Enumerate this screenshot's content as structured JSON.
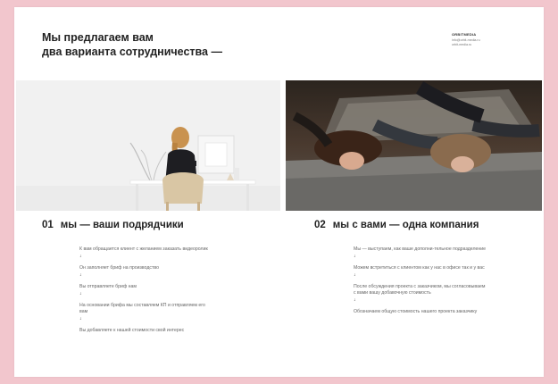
{
  "header": {
    "title_line1": "Мы предлагаем вам",
    "title_line2": "два варианта сотрудничества —"
  },
  "brand": {
    "name": "ORBITMEDIA",
    "contact1": "info@orbit-media.ru",
    "contact2": "orbit-media.ru"
  },
  "sections": [
    {
      "number": "01",
      "heading": "мы — ваши подрядчики",
      "steps": [
        "К вам обращается клиент с желанием заказать видеоролик",
        "Он заполняет бриф на производство",
        "Вы отправляете бриф нам",
        "На основании брифа мы составляем КП и отправляем его вам",
        "Вы добавляете к нашей стоимости свой интерес"
      ]
    },
    {
      "number": "02",
      "heading": "мы с вами — одна компания",
      "steps": [
        "Мы — выступаем, как ваше дополни-тельное подразделение",
        "Можем встретиться с клиентом как у нас в офисе так и у вас",
        "После обсуждения проекта с заказчиком, мы согласовываем с вами вашу добавочную стоимость",
        "Обозначаем общую стоимость нашего проекта заказчику"
      ]
    }
  ],
  "arrow_glyph": "↓",
  "colors": {
    "background": "#f2c6cd",
    "sheet": "#ffffff",
    "text": "#222222",
    "muted": "#666666"
  }
}
